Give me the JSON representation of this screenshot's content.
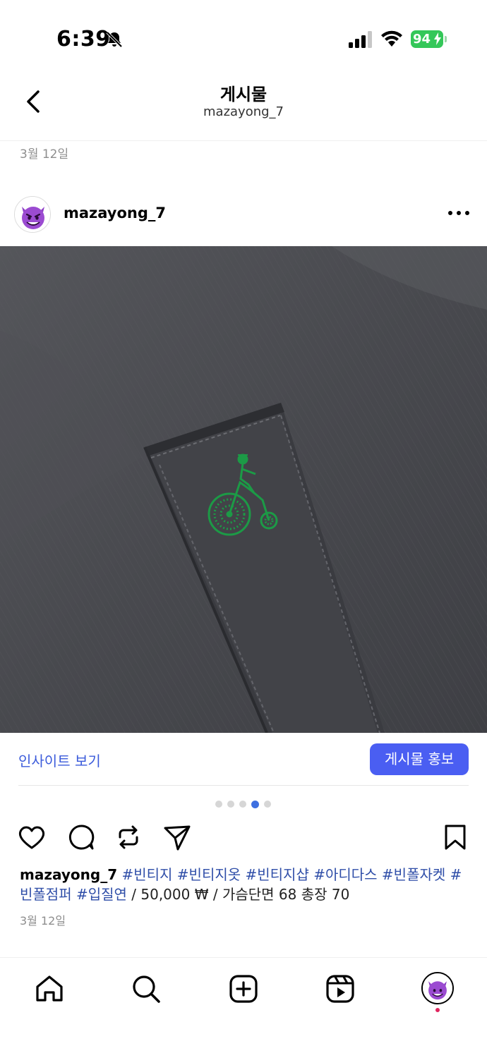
{
  "status_bar": {
    "time": "6:39",
    "battery": "94",
    "icons": [
      "mute-icon",
      "signal-icon",
      "wifi-icon",
      "battery-icon"
    ]
  },
  "header": {
    "title": "게시물",
    "subtitle": "mazayong_7",
    "back_icon": "chevron-left-icon"
  },
  "top_date": "3월 12일",
  "post": {
    "username": "mazayong_7",
    "avatar_icon": "smiling-devil-icon",
    "more_icon": "more-horizontal-icon",
    "image_subject": "embroidered-penny-farthing-logo",
    "accent_color": "#1c9a46"
  },
  "insight": {
    "link_label": "인사이트 보기",
    "promote_label": "게시물 홍보",
    "link_color": "#3b5bdb",
    "button_color": "#4a5ef2"
  },
  "carousel": {
    "count": 5,
    "active_index": 3
  },
  "actions": [
    "heart-icon",
    "comment-icon",
    "repost-icon",
    "share-icon",
    "bookmark-icon"
  ],
  "caption": {
    "username": "mazayong_7",
    "tags": " #빈티지 #빈티지옷 #빈티지샵 #아디다스 #빈폴자켓 #빈폴점퍼 #입질연",
    "text": " / 50,000 ₩ / 가슴단면 68 총장 70"
  },
  "bottom_date": "3월 12일",
  "tab_bar": [
    "home-icon",
    "search-icon",
    "create-icon",
    "reels-icon",
    "profile-avatar"
  ]
}
